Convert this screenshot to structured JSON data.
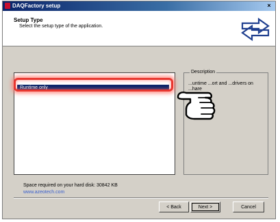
{
  "window": {
    "title": "DAQFactory setup",
    "close_glyph": "×"
  },
  "header": {
    "title": "Setup Type",
    "subtitle": "Select the setup type of the application."
  },
  "setup_list": {
    "items": [
      "Runtime only"
    ]
  },
  "description": {
    "legend": "Description",
    "text": "...untime ...ort and ...drivers on ...hare"
  },
  "status": {
    "space_required": "Space required on your hard disk: 30842 KB",
    "link": "www.azeotech.com"
  },
  "buttons": {
    "back": "< Back",
    "next": "Next >",
    "cancel": "Cancel"
  },
  "colors": {
    "title_bar": "#0a246a",
    "selection": "#0a246a",
    "highlight": "#e8362f",
    "dialog": "#d4d0c8"
  }
}
